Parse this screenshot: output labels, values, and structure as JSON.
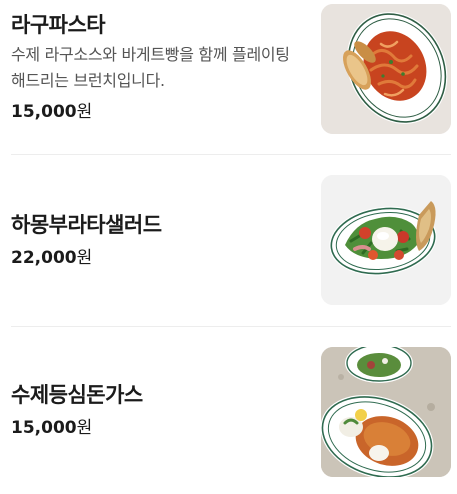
{
  "menu": {
    "items": [
      {
        "name": "라구파스타",
        "description": "수제 라구소스와 바게트빵을 함께 플레이팅 해드리는 브런치입니다.",
        "price": "15,000",
        "currency": "원",
        "image_icon": "ragu-pasta-photo"
      },
      {
        "name": "하몽부라타샐러드",
        "price": "22,000",
        "currency": "원",
        "image_icon": "burrata-salad-photo"
      },
      {
        "name": "수제등심돈가스",
        "price": "15,000",
        "currency": "원",
        "image_icon": "pork-cutlet-photo"
      }
    ]
  }
}
